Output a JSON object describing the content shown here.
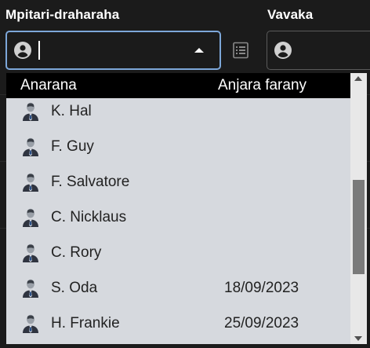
{
  "fields": {
    "left_label": "Mpitari-draharaha",
    "right_label": "Vavaka",
    "left_input_value": ""
  },
  "icons": {
    "field_person": "account-circle-icon",
    "list": "list-icon",
    "row_person": "person-avatar-icon",
    "dropdown_toggle": "caret-up-icon"
  },
  "colors": {
    "focus_border": "#7da7d9",
    "dropdown_bg": "#d6d9de",
    "header_bg": "#000000"
  },
  "dropdown": {
    "headers": {
      "name": "Anarana",
      "last_date": "Anjara farany"
    },
    "rows": [
      {
        "name": "K. Hal",
        "date": ""
      },
      {
        "name": "F. Guy",
        "date": ""
      },
      {
        "name": "F. Salvatore",
        "date": ""
      },
      {
        "name": "C. Nicklaus",
        "date": ""
      },
      {
        "name": "C. Rory",
        "date": ""
      },
      {
        "name": "S. Oda",
        "date": "18/09/2023"
      },
      {
        "name": "H. Frankie",
        "date": "25/09/2023"
      }
    ],
    "scroll_position": 0.62,
    "visible_fraction": 0.38
  }
}
